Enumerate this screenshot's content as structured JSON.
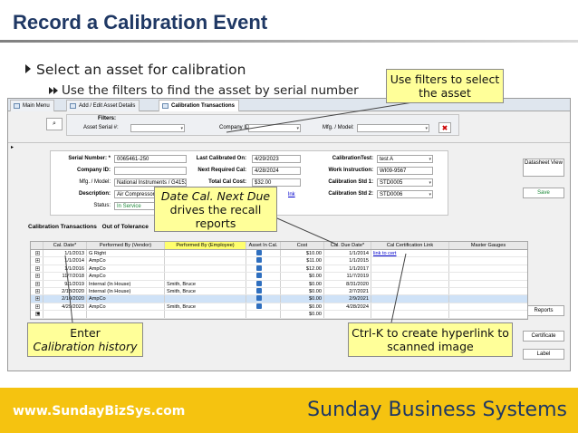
{
  "slide": {
    "title": "Record a Calibration Event",
    "bullet1": "Select an asset for calibration",
    "bullet2": "Use the filters to find the asset by serial number"
  },
  "window": {
    "tabs": [
      "Main Menu",
      "Add / Edit Asset Details",
      "Calibration Transactions"
    ],
    "filters": {
      "heading": "Filters:",
      "asset_serial_label": "Asset Serial #:",
      "asset_serial_value": "",
      "company_label": "Company ID:",
      "company_value": "",
      "mfg_label": "Mfg. / Model:",
      "mfg_value": ""
    },
    "side_buttons": {
      "datasheet": "Datasheet View",
      "save": "Save",
      "reports": "Reports",
      "certificate": "Certificate",
      "label": "Label"
    },
    "detail": {
      "serial_label": "Serial Number: *",
      "serial_value": "0065461-250",
      "company_label": "Company ID:",
      "company_value": "",
      "mfg_label": "Mfg. / Model:",
      "mfg_value": "National Instruments / G4153",
      "description_label": "Description:",
      "description_value": "Air Compressor",
      "status_label": "Status:",
      "status_value": "In Service",
      "last_cal_label": "Last Calibrated On:",
      "last_cal_value": "4/29/2023",
      "next_cal_label": "Next Required Cal:",
      "next_cal_value": "4/28/2024",
      "total_cost_label": "Total Cal Cost:",
      "total_cost_value": "$32.00",
      "link_text": "lnk",
      "cal_test_label": "CalibrationTest:",
      "cal_test_value": "test A",
      "work_instr_label": "Work Instruction:",
      "work_instr_value": "WI09-9567",
      "std1_label": "Calibration Std 1:",
      "std1_value": "STD0005",
      "std2_label": "Calibration Std 2:",
      "std2_value": "STD0006"
    },
    "subtabs": [
      "Calibration Transactions",
      "Out of Tolerance"
    ],
    "grid": {
      "columns": [
        "Cal. Date*",
        "Performed By (Vendor)",
        "Performed By (Employee)",
        "Asset In Cal.",
        "Cost",
        "Cal. Due Date*",
        "Cal Certification Link",
        "Master Gauges"
      ],
      "rows": [
        {
          "date": "1/1/2013",
          "vendor": "G Right",
          "employee": "",
          "in_cal": true,
          "cost": "$10.00",
          "due": "1/1/2014",
          "link": "link to cert",
          "gauges": ""
        },
        {
          "date": "1/1/2014",
          "vendor": "AmpCo",
          "employee": "",
          "in_cal": true,
          "cost": "$11.00",
          "due": "1/1/2015",
          "link": "",
          "gauges": ""
        },
        {
          "date": "1/1/2016",
          "vendor": "AmpCo",
          "employee": "",
          "in_cal": true,
          "cost": "$12.00",
          "due": "1/1/2017",
          "link": "",
          "gauges": ""
        },
        {
          "date": "11/7/2018",
          "vendor": "AmpCo",
          "employee": "",
          "in_cal": true,
          "cost": "$0.00",
          "due": "11/7/2019",
          "link": "",
          "gauges": ""
        },
        {
          "date": "9/1/2019",
          "vendor": "Internal (In House)",
          "employee": "Smith, Bruce",
          "in_cal": true,
          "cost": "$0.00",
          "due": "8/31/2020",
          "link": "",
          "gauges": ""
        },
        {
          "date": "2/18/2020",
          "vendor": "Internal (In House)",
          "employee": "Smith, Bruce",
          "in_cal": true,
          "cost": "$0.00",
          "due": "2/7/2021",
          "link": "",
          "gauges": ""
        },
        {
          "date": "2/10/2020",
          "vendor": "AmpCo",
          "employee": "",
          "in_cal": true,
          "cost": "$0.00",
          "due": "2/9/2021",
          "link": "",
          "gauges": ""
        },
        {
          "date": "4/29/2023",
          "vendor": "AmpCo",
          "employee": "Smith, Bruce",
          "in_cal": true,
          "cost": "$0.00",
          "due": "4/28/2024",
          "link": "",
          "gauges": ""
        },
        {
          "date": "",
          "vendor": "",
          "employee": "",
          "in_cal": false,
          "cost": "$0.00",
          "due": "",
          "link": "",
          "gauges": ""
        }
      ]
    }
  },
  "callouts": {
    "filters": "Use filters to select the asset",
    "date_line1": "Date Cal. Next Due",
    "date_line2": "drives the recall reports",
    "enter_line1": "Enter",
    "enter_line2": "Calibration history",
    "ctrlk": "Ctrl-K to create hyperlink to scanned image"
  },
  "footer": {
    "url": "www.SundayBizSys.com",
    "company": "Sunday Business Systems"
  },
  "colors": {
    "title": "#1f3864",
    "footer_bg": "#f5c310",
    "callout_yellow": "#ffff99",
    "highlight_header": "#ffff6e"
  }
}
